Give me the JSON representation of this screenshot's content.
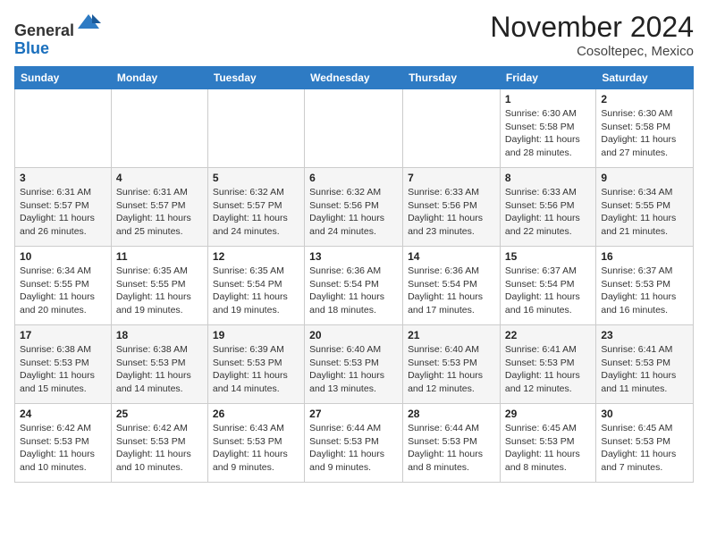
{
  "header": {
    "logo_line1": "General",
    "logo_line2": "Blue",
    "month_title": "November 2024",
    "location": "Cosoltepec, Mexico"
  },
  "weekdays": [
    "Sunday",
    "Monday",
    "Tuesday",
    "Wednesday",
    "Thursday",
    "Friday",
    "Saturday"
  ],
  "weeks": [
    [
      {
        "day": "",
        "info": ""
      },
      {
        "day": "",
        "info": ""
      },
      {
        "day": "",
        "info": ""
      },
      {
        "day": "",
        "info": ""
      },
      {
        "day": "",
        "info": ""
      },
      {
        "day": "1",
        "info": "Sunrise: 6:30 AM\nSunset: 5:58 PM\nDaylight: 11 hours and 28 minutes."
      },
      {
        "day": "2",
        "info": "Sunrise: 6:30 AM\nSunset: 5:58 PM\nDaylight: 11 hours and 27 minutes."
      }
    ],
    [
      {
        "day": "3",
        "info": "Sunrise: 6:31 AM\nSunset: 5:57 PM\nDaylight: 11 hours and 26 minutes."
      },
      {
        "day": "4",
        "info": "Sunrise: 6:31 AM\nSunset: 5:57 PM\nDaylight: 11 hours and 25 minutes."
      },
      {
        "day": "5",
        "info": "Sunrise: 6:32 AM\nSunset: 5:57 PM\nDaylight: 11 hours and 24 minutes."
      },
      {
        "day": "6",
        "info": "Sunrise: 6:32 AM\nSunset: 5:56 PM\nDaylight: 11 hours and 24 minutes."
      },
      {
        "day": "7",
        "info": "Sunrise: 6:33 AM\nSunset: 5:56 PM\nDaylight: 11 hours and 23 minutes."
      },
      {
        "day": "8",
        "info": "Sunrise: 6:33 AM\nSunset: 5:56 PM\nDaylight: 11 hours and 22 minutes."
      },
      {
        "day": "9",
        "info": "Sunrise: 6:34 AM\nSunset: 5:55 PM\nDaylight: 11 hours and 21 minutes."
      }
    ],
    [
      {
        "day": "10",
        "info": "Sunrise: 6:34 AM\nSunset: 5:55 PM\nDaylight: 11 hours and 20 minutes."
      },
      {
        "day": "11",
        "info": "Sunrise: 6:35 AM\nSunset: 5:55 PM\nDaylight: 11 hours and 19 minutes."
      },
      {
        "day": "12",
        "info": "Sunrise: 6:35 AM\nSunset: 5:54 PM\nDaylight: 11 hours and 19 minutes."
      },
      {
        "day": "13",
        "info": "Sunrise: 6:36 AM\nSunset: 5:54 PM\nDaylight: 11 hours and 18 minutes."
      },
      {
        "day": "14",
        "info": "Sunrise: 6:36 AM\nSunset: 5:54 PM\nDaylight: 11 hours and 17 minutes."
      },
      {
        "day": "15",
        "info": "Sunrise: 6:37 AM\nSunset: 5:54 PM\nDaylight: 11 hours and 16 minutes."
      },
      {
        "day": "16",
        "info": "Sunrise: 6:37 AM\nSunset: 5:53 PM\nDaylight: 11 hours and 16 minutes."
      }
    ],
    [
      {
        "day": "17",
        "info": "Sunrise: 6:38 AM\nSunset: 5:53 PM\nDaylight: 11 hours and 15 minutes."
      },
      {
        "day": "18",
        "info": "Sunrise: 6:38 AM\nSunset: 5:53 PM\nDaylight: 11 hours and 14 minutes."
      },
      {
        "day": "19",
        "info": "Sunrise: 6:39 AM\nSunset: 5:53 PM\nDaylight: 11 hours and 14 minutes."
      },
      {
        "day": "20",
        "info": "Sunrise: 6:40 AM\nSunset: 5:53 PM\nDaylight: 11 hours and 13 minutes."
      },
      {
        "day": "21",
        "info": "Sunrise: 6:40 AM\nSunset: 5:53 PM\nDaylight: 11 hours and 12 minutes."
      },
      {
        "day": "22",
        "info": "Sunrise: 6:41 AM\nSunset: 5:53 PM\nDaylight: 11 hours and 12 minutes."
      },
      {
        "day": "23",
        "info": "Sunrise: 6:41 AM\nSunset: 5:53 PM\nDaylight: 11 hours and 11 minutes."
      }
    ],
    [
      {
        "day": "24",
        "info": "Sunrise: 6:42 AM\nSunset: 5:53 PM\nDaylight: 11 hours and 10 minutes."
      },
      {
        "day": "25",
        "info": "Sunrise: 6:42 AM\nSunset: 5:53 PM\nDaylight: 11 hours and 10 minutes."
      },
      {
        "day": "26",
        "info": "Sunrise: 6:43 AM\nSunset: 5:53 PM\nDaylight: 11 hours and 9 minutes."
      },
      {
        "day": "27",
        "info": "Sunrise: 6:44 AM\nSunset: 5:53 PM\nDaylight: 11 hours and 9 minutes."
      },
      {
        "day": "28",
        "info": "Sunrise: 6:44 AM\nSunset: 5:53 PM\nDaylight: 11 hours and 8 minutes."
      },
      {
        "day": "29",
        "info": "Sunrise: 6:45 AM\nSunset: 5:53 PM\nDaylight: 11 hours and 8 minutes."
      },
      {
        "day": "30",
        "info": "Sunrise: 6:45 AM\nSunset: 5:53 PM\nDaylight: 11 hours and 7 minutes."
      }
    ]
  ]
}
